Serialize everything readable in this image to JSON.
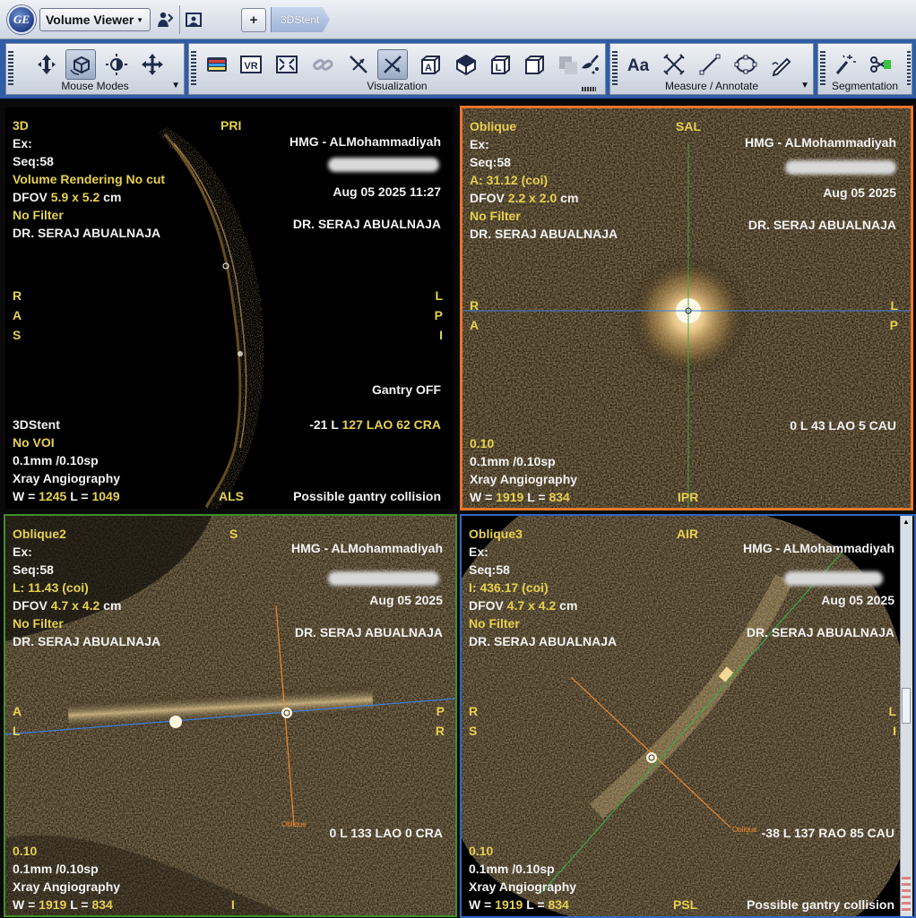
{
  "app": {
    "menu_button": "Volume Viewer",
    "tab_label": "3DStent",
    "plus_label": "+"
  },
  "toolbar": {
    "groups": [
      {
        "label": "Mouse Modes"
      },
      {
        "label": "Visualization"
      },
      {
        "label": "Measure / Annotate"
      },
      {
        "label": "Segmentation"
      }
    ],
    "vr_label": "VR"
  },
  "viewports": {
    "tl": {
      "name": "3D",
      "orient_top": "PRI",
      "ex": "Ex:",
      "seq": "Seq:58",
      "mode": "Volume Rendering No cut",
      "dfov_prefix": "DFOV ",
      "dfov_val": "5.9 x 5.2",
      "dfov_unit": " cm",
      "filter": "No Filter",
      "doctor_left": "DR. SERAJ ABUALNAJA",
      "hospital": "HMG - ALMohammadiyah",
      "date": "Aug 05 2025 11:27",
      "doctor_right": "DR. SERAJ ABUALNAJA",
      "left_orient": [
        "R",
        "A",
        "S"
      ],
      "right_orient": [
        "L",
        "P",
        "I"
      ],
      "gantry": "Gantry OFF",
      "protocol": "3DStent",
      "voi": "No VOI",
      "thickness": "0.1mm /0.10sp",
      "modality": "Xray Angiography",
      "wl_w_label": "W = ",
      "wl_w": "1245",
      "wl_l_label": " L = ",
      "wl_l": "1049",
      "angle_prefix": "-21 L ",
      "angle_val": "127 LAO 62 CRA",
      "orient_bottom": "ALS",
      "collision": "Possible gantry collision"
    },
    "tr": {
      "name": "Oblique",
      "orient_top": "SAL",
      "ex": "Ex:",
      "seq": "Seq:58",
      "coord": "A: 31.12 (coi)",
      "dfov_prefix": "DFOV ",
      "dfov_val": "2.2 x 2.0",
      "dfov_unit": " cm",
      "filter": "No Filter",
      "doctor_left": "DR. SERAJ ABUALNAJA",
      "hospital": "HMG - ALMohammadiyah",
      "date": "Aug 05 2025",
      "doctor_right": "DR. SERAJ ABUALNAJA",
      "left_orient": [
        "R",
        "A"
      ],
      "right_orient": [
        "L",
        "P"
      ],
      "angle": "0 L 43 LAO 5 CAU",
      "zoom": "0.10",
      "thickness": "0.1mm /0.10sp",
      "modality": "Xray Angiography",
      "wl_w_label": "W = ",
      "wl_w": "1919",
      "wl_l_label": " L = ",
      "wl_l": "834",
      "orient_bottom": "IPR"
    },
    "bl": {
      "name": "Oblique2",
      "orient_top": "S",
      "ex": "Ex:",
      "seq": "Seq:58",
      "coord": "L: 11.43 (coi)",
      "dfov_prefix": "DFOV ",
      "dfov_val": "4.7 x 4.2",
      "dfov_unit": " cm",
      "filter": "No Filter",
      "doctor_left": "DR. SERAJ ABUALNAJA",
      "hospital": "HMG - ALMohammadiyah",
      "date": "Aug 05 2025",
      "doctor_right": "DR. SERAJ ABUALNAJA",
      "left_orient": [
        "A",
        "L"
      ],
      "right_orient": [
        "P",
        "R"
      ],
      "line_label": "Oblique",
      "angle": "0 L 133 LAO 0 CRA",
      "zoom": "0.10",
      "thickness": "0.1mm /0.10sp",
      "modality": "Xray Angiography",
      "wl_w_label": "W = ",
      "wl_w": "1919",
      "wl_l_label": " L = ",
      "wl_l": "834",
      "orient_bottom": "I"
    },
    "br": {
      "name": "Oblique3",
      "orient_top": "AIR",
      "ex": "Ex:",
      "seq": "Seq:58",
      "coord": "I: 436.17 (coi)",
      "dfov_prefix": "DFOV ",
      "dfov_val": "4.7 x 4.2",
      "dfov_unit": " cm",
      "filter": "No Filter",
      "doctor_left": "DR. SERAJ ABUALNAJA",
      "hospital": "HMG - ALMohammadiyah",
      "date": "Aug 05 2025",
      "doctor_right": "DR. SERAJ ABUALNAJA",
      "left_orient": [
        "R",
        "S"
      ],
      "right_orient": [
        "L",
        "I"
      ],
      "line_label": "Oblique",
      "angle": "-38 L 137 RAO 85 CAU",
      "zoom": "0.10",
      "thickness": "0.1mm /0.10sp",
      "modality": "Xray Angiography",
      "wl_w_label": "W = ",
      "wl_w": "1919",
      "wl_l_label": " L = ",
      "wl_l": "834",
      "orient_bottom": "PSL",
      "collision": "Possible gantry collision"
    }
  },
  "colors": {
    "border_tr": "#e8772a",
    "border_bl": "#3f8f2d",
    "border_br": "#2f68c4",
    "overlay_yellow": "#e6d14e",
    "toolbar_blue": "#2f5da6"
  }
}
